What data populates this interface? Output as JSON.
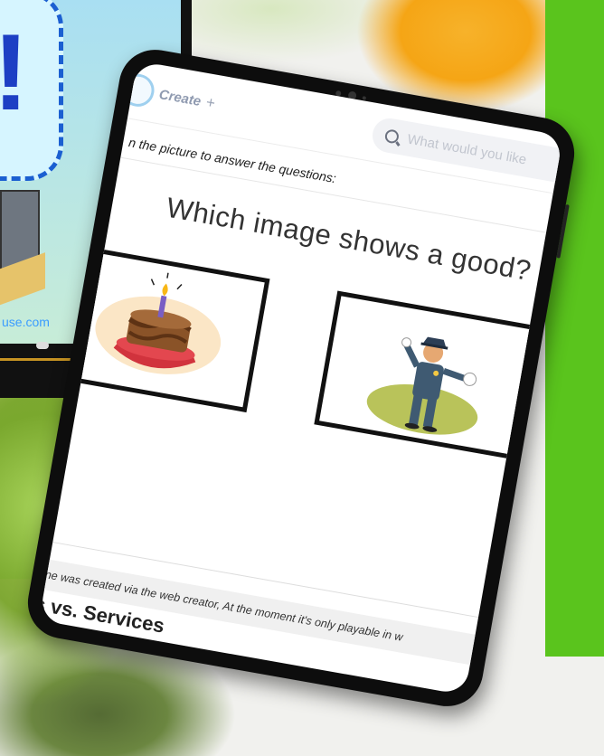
{
  "background": {
    "video_url_fragment": "use.com",
    "accent_green": "#5ac41d"
  },
  "app": {
    "create_label": "Create",
    "create_plus": "+",
    "search_placeholder": "What would you like"
  },
  "activity": {
    "instructions": "n the picture to answer the questions:",
    "question": "Which image shows a good?",
    "options": [
      {
        "icon": "birthday-cake-icon"
      },
      {
        "icon": "police-officer-icon"
      }
    ]
  },
  "footer": {
    "note": "ne was created via the web creator, At the moment it's only playable in w",
    "section_title": "s vs. Services"
  }
}
